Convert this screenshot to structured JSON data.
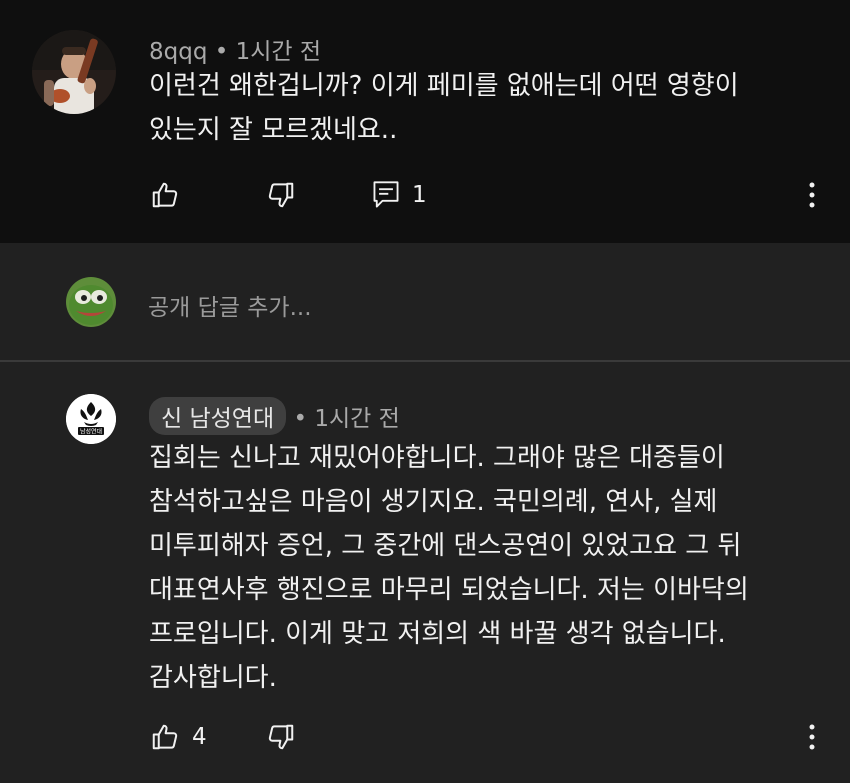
{
  "comment1": {
    "author": "8qqq",
    "time": "• 1시간 전",
    "lines": [
      "이런건 왜한겁니까? 이게 페미를 없애는데 어떤 영향이",
      "있는지 잘 모르겠네요.."
    ],
    "reply_count": "1",
    "icons": [
      "thumbs-up-icon",
      "thumbs-down-icon",
      "comment-icon",
      "more-vert-icon"
    ]
  },
  "reply_box": {
    "placeholder": "공개 답글 추가..."
  },
  "comment2": {
    "author": "신 남성연대",
    "time": "• 1시간 전",
    "lines": [
      "집회는 신나고 재밌어야합니다. 그래야 많은 대중들이",
      "참석하고싶은 마음이 생기지요. 국민의례, 연사, 실제",
      "미투피해자 증언, 그 중간에 댄스공연이 있었고요 그 뒤",
      "대표연사후 행진으로 마무리 되었습니다. 저는 이바닥의",
      "프로입니다. 이게 맞고 저희의 색 바꿀 생각 없습니다.",
      "감사합니다."
    ],
    "like_count": "4",
    "avatar_logo_text": "남성연대",
    "icons": [
      "thumbs-up-icon",
      "thumbs-down-icon",
      "more-vert-icon"
    ]
  },
  "colors": {
    "background_top": "#0f0f0f",
    "background_reply": "#212121",
    "text_primary": "#f1f1f1",
    "text_secondary": "#aaaaaa",
    "author_chip": "#3f3f3f"
  }
}
